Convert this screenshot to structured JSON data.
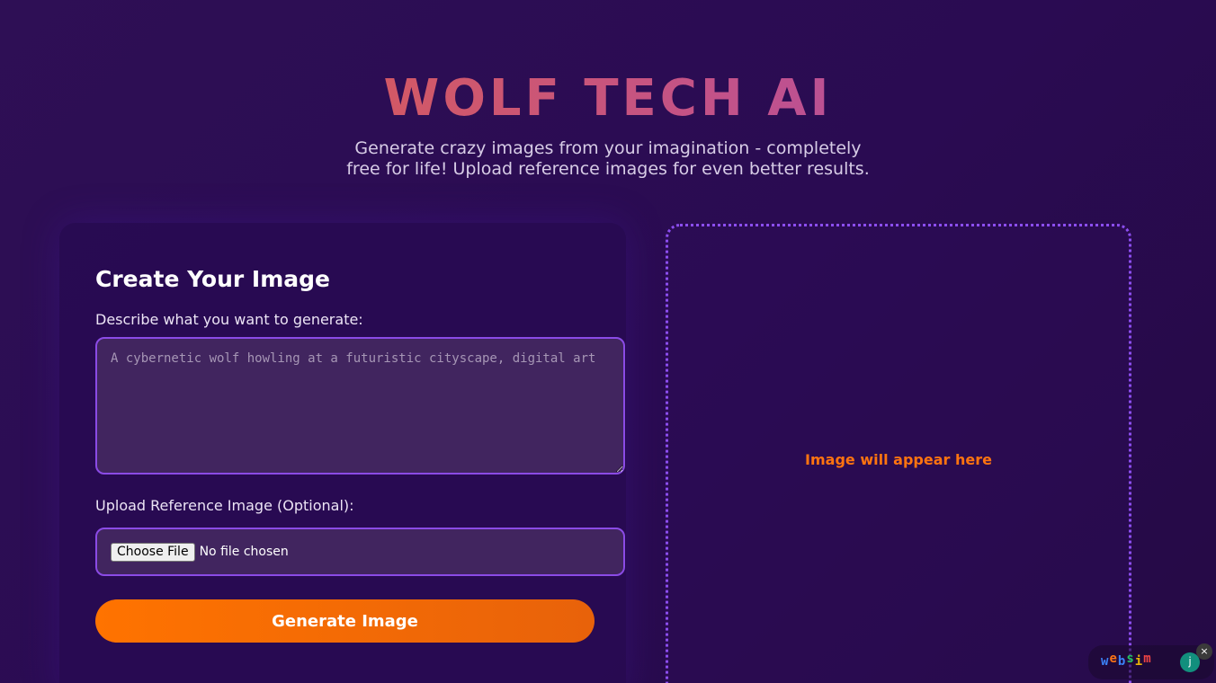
{
  "header": {
    "title": "WOLF TECH AI",
    "subtitle": "Generate crazy images from your imagination - completely free for life! Upload reference images for even better results."
  },
  "form": {
    "title": "Create Your Image",
    "prompt_label": "Describe what you want to generate:",
    "prompt_placeholder": "A cybernetic wolf howling at a futuristic cityscape, digital art",
    "prompt_value": "",
    "upload_label": "Upload Reference Image (Optional):",
    "choose_file_label": "Choose File",
    "file_status": "No file chosen",
    "generate_label": "Generate Image"
  },
  "preview": {
    "placeholder": "Image will appear here"
  },
  "badge": {
    "logo_letters": [
      {
        "char": "w",
        "color": "#3b82f6"
      },
      {
        "char": "e",
        "color": "#f97316"
      },
      {
        "char": "b",
        "color": "#3b82f6"
      },
      {
        "char": "s",
        "color": "#22c55e"
      },
      {
        "char": "i",
        "color": "#eab308"
      },
      {
        "char": "m",
        "color": "#ef4444"
      }
    ],
    "avatar_initial": "j",
    "close_glyph": "×"
  },
  "colors": {
    "accent_purple": "#8b4be6",
    "accent_orange": "#ff7300",
    "background": "#2a0b52"
  }
}
